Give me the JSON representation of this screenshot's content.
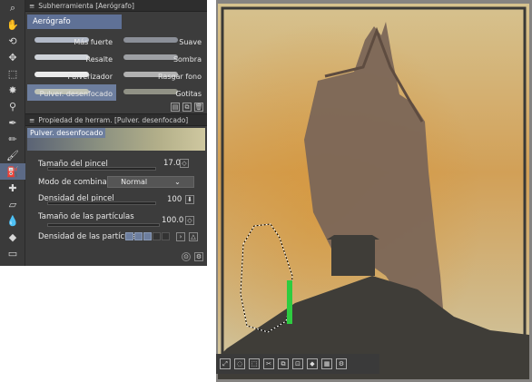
{
  "tools": [
    {
      "name": "zoom-icon",
      "glyph": "⌕"
    },
    {
      "name": "hand-icon",
      "glyph": "✋"
    },
    {
      "name": "rotate-icon",
      "glyph": "⟲"
    },
    {
      "name": "move-icon",
      "glyph": "✥"
    },
    {
      "name": "selection-icon",
      "glyph": "⬚"
    },
    {
      "name": "magic-wand-icon",
      "glyph": "✸"
    },
    {
      "name": "eyedropper-icon",
      "glyph": "⚲"
    },
    {
      "name": "pen-icon",
      "glyph": "✒"
    },
    {
      "name": "pencil-icon",
      "glyph": "✏"
    },
    {
      "name": "brush-icon",
      "glyph": "🖌"
    },
    {
      "name": "airbrush-icon",
      "glyph": "⛽",
      "active": true
    },
    {
      "name": "decoration-icon",
      "glyph": "✚"
    },
    {
      "name": "eraser-icon",
      "glyph": "▱"
    },
    {
      "name": "blend-icon",
      "glyph": "💧"
    },
    {
      "name": "fill-icon",
      "glyph": "◆"
    },
    {
      "name": "gradient-icon",
      "glyph": "▭"
    }
  ],
  "subtool": {
    "title": "Subherramienta [Aerógrafo]",
    "group": "Aerógrafo",
    "brushes": [
      [
        "Más fuerte",
        "Suave"
      ],
      [
        "Resalte",
        "Sombra"
      ],
      [
        "Pulverizador",
        "Rasgar fono"
      ],
      [
        "Pulver. desenfocado",
        "Gotitas"
      ]
    ],
    "selected_brush": "Pulver. desenfocado"
  },
  "toolprop": {
    "title": "Propiedad de herram. [Pulver. desenfocado]",
    "preview_label": "Pulver. desenfocado",
    "brush_size_label": "Tamaño del pincel",
    "brush_size_value": "17.0",
    "blend_mode_label": "Modo de combinación",
    "blend_mode_value": "Normal",
    "brush_density_label": "Densidad del pincel",
    "brush_density_value": "100",
    "particle_size_label": "Tamaño de las partículas",
    "particle_size_value": "100.0",
    "particle_density_label": "Densidad de las partículas"
  },
  "bottombar_icons": [
    "expand-icon",
    "select-all-icon",
    "deselect-icon",
    "cut-icon",
    "copy-icon",
    "crop-icon",
    "fill-selection-icon",
    "transparent-icon",
    "settings-icon"
  ]
}
